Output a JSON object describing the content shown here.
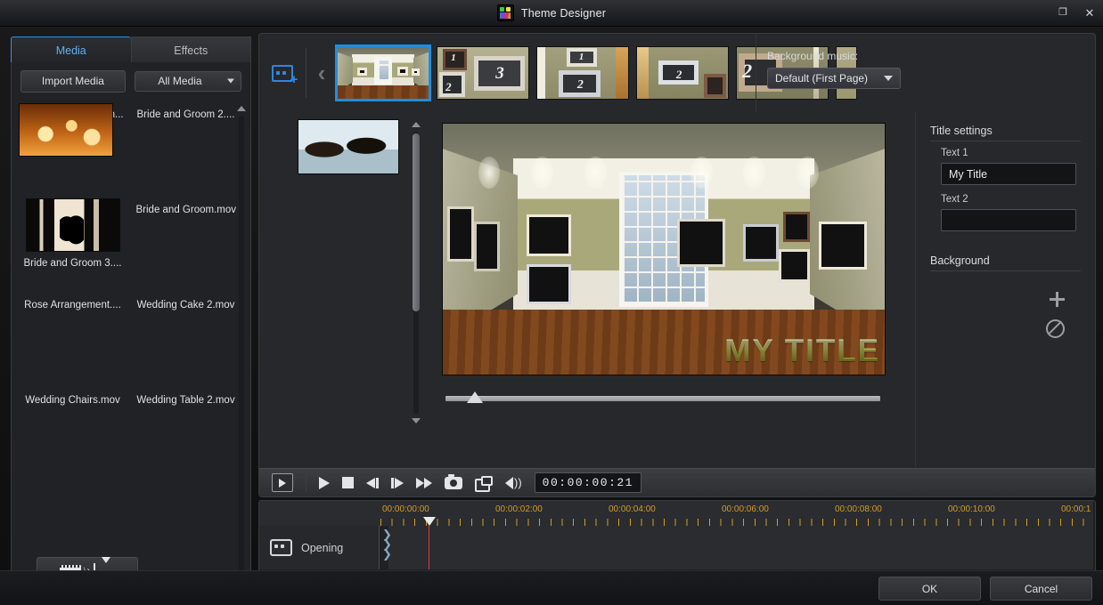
{
  "window": {
    "title": "Theme Designer",
    "icon": "app-icon",
    "maximize_label": "❐",
    "close_label": "✕"
  },
  "library": {
    "tabs": [
      {
        "label": "Media",
        "active": true
      },
      {
        "label": "Effects",
        "active": false
      }
    ],
    "import_label": "Import Media",
    "filter_value": "All Media",
    "add_to_timeline_title": "Add to timeline",
    "items": [
      {
        "name": "Arranged Flowers.m...",
        "art": "flowers"
      },
      {
        "name": "Bride and Groom 2....",
        "art": "couple1"
      },
      {
        "name": "Bride and Groom 3....",
        "art": "couple3"
      },
      {
        "name": "Bride and Groom.mov",
        "art": "couple4"
      },
      {
        "name": "Rose Arrangement....",
        "art": "roses"
      },
      {
        "name": "Wedding Cake 2.mov",
        "art": "cake"
      },
      {
        "name": "Wedding Chairs.mov",
        "art": "chairs"
      },
      {
        "name": "Wedding Table 2.mov",
        "art": "table"
      }
    ]
  },
  "filmstrip": {
    "add_page_label": "add-page",
    "prev_label": "‹",
    "next_label": "›",
    "pages": [
      {
        "label": "",
        "selected": true,
        "kind": "room"
      },
      {
        "label": "3",
        "sub": "1",
        "sub2": "2",
        "selected": false,
        "kind": "frames"
      },
      {
        "label": "2",
        "sub": "1",
        "selected": false,
        "kind": "frames"
      },
      {
        "label": "2",
        "selected": false,
        "kind": "frames"
      },
      {
        "label": "2",
        "selected": false,
        "kind": "frames"
      },
      {
        "label": "",
        "selected": false,
        "kind": "partial"
      }
    ]
  },
  "music": {
    "label": "Background music:",
    "value": "Default (First Page)"
  },
  "queue": {
    "items": [
      "flowers",
      "couple1",
      "couple3",
      "couple4"
    ]
  },
  "preview": {
    "title_overlay": "MY TITLE"
  },
  "settings": {
    "title_section": "Title settings",
    "text1_label": "Text 1",
    "text1_value": "My Title",
    "text1_placeholder": "",
    "text2_label": "Text 2",
    "text2_value": "",
    "text2_placeholder": "",
    "background_section": "Background",
    "add_icon": "plus-icon",
    "none_icon": "no-background-icon"
  },
  "transport": {
    "preview_mode": "preview-mode-button",
    "play": "play-button",
    "stop": "stop-button",
    "prev_frame": "previous-frame-button",
    "next_frame": "next-frame-button",
    "fast_forward": "fast-forward-button",
    "snapshot": "snapshot-button",
    "dual_preview": "dual-preview-button",
    "volume": "volume-button",
    "timecode": "00:00:00:21"
  },
  "timeline": {
    "ruler_labels": [
      "00:00:00:00",
      "00:00:02:00",
      "00:00:04:00",
      "00:00:06:00",
      "00:00:08:00",
      "00:00:10:00",
      "00:00:1"
    ],
    "track_name": "Opening",
    "track_icon": "clip-icon",
    "zoom_out": "zoom-out-button",
    "zoom_in": "zoom-in-button"
  },
  "footer": {
    "ok_label": "OK",
    "cancel_label": "Cancel"
  },
  "colors": {
    "accent_blue": "#3b8fd8",
    "tab_active_text": "#5fb0ee",
    "ruler_text": "#d79c24",
    "playhead_red": "#e03b3b",
    "panel_bg": "#26282b"
  }
}
